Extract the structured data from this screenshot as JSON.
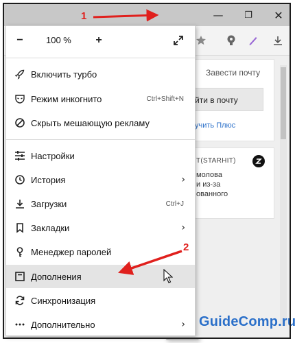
{
  "window": {
    "menu_icon": "hamburger-icon",
    "minimize_glyph": "—",
    "maximize_glyph": "❐",
    "close_glyph": "✕"
  },
  "toolbar": {
    "icons": [
      "star-icon",
      "lightbulb-icon",
      "pen-icon",
      "download-icon"
    ]
  },
  "page": {
    "mail_header": "Завести почту",
    "login_button": "йти в почту",
    "plus_link": "учить Плюс",
    "news_source": "Т(STARHIT)",
    "news_line1": "молова",
    "news_line2": "и из-за",
    "news_line3": "ованного"
  },
  "menu": {
    "zoom": {
      "minus": "−",
      "value": "100 %",
      "plus": "+"
    },
    "group1": [
      {
        "label": "Включить турбо",
        "icon": "rocket-icon",
        "shortcut": ""
      },
      {
        "label": "Режим инкогнито",
        "icon": "incognito-icon",
        "shortcut": "Ctrl+Shift+N"
      },
      {
        "label": "Скрыть мешающую рекламу",
        "icon": "block-icon",
        "shortcut": ""
      }
    ],
    "group2": [
      {
        "label": "Настройки",
        "icon": "sliders-icon",
        "shortcut": "",
        "submenu": false
      },
      {
        "label": "История",
        "icon": "clock-icon",
        "shortcut": "",
        "submenu": true
      },
      {
        "label": "Загрузки",
        "icon": "download-icon",
        "shortcut": "Ctrl+J",
        "submenu": false
      },
      {
        "label": "Закладки",
        "icon": "bookmark-icon",
        "shortcut": "",
        "submenu": true
      },
      {
        "label": "Менеджер паролей",
        "icon": "key-icon",
        "shortcut": "",
        "submenu": false
      },
      {
        "label": "Дополнения",
        "icon": "extensions-icon",
        "shortcut": "",
        "submenu": false,
        "highlighted": true
      },
      {
        "label": "Синхронизация",
        "icon": "sync-icon",
        "shortcut": "",
        "submenu": false
      },
      {
        "label": "Дополнительно",
        "icon": "more-icon",
        "shortcut": "",
        "submenu": true
      }
    ],
    "submenu_arrow": "›"
  },
  "annotations": {
    "step1": "1",
    "step2": "2",
    "arrow_color": "#e0201d"
  },
  "watermark": "GuideComp.ru",
  "colors": {
    "accent_blue": "#2a6fc9",
    "annotation_red": "#e0201d",
    "hover_gray": "#e4e4e4"
  }
}
